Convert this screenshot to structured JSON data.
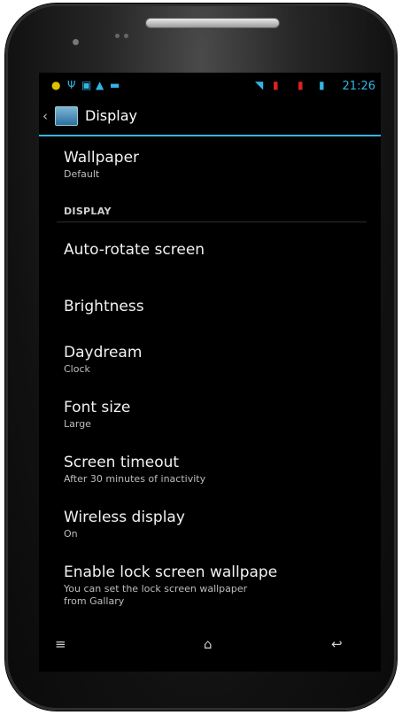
{
  "status_bar": {
    "time": "21:26",
    "icons": [
      "notification-icon",
      "usb-icon",
      "image-icon",
      "warning-icon",
      "game-icon",
      "wifi-icon",
      "signal-icon",
      "signal-icon",
      "battery-icon"
    ]
  },
  "action_bar": {
    "title": "Display"
  },
  "settings": {
    "wallpaper": {
      "title": "Wallpaper",
      "summary": "Default"
    },
    "category": "DISPLAY",
    "auto_rotate": {
      "title": "Auto-rotate screen"
    },
    "brightness": {
      "title": "Brightness"
    },
    "daydream": {
      "title": "Daydream",
      "summary": "Clock"
    },
    "font_size": {
      "title": "Font size",
      "summary": "Large"
    },
    "screen_timeout": {
      "title": "Screen timeout",
      "summary": "After 30 minutes of inactivity"
    },
    "wireless_display": {
      "title": "Wireless display",
      "summary": "On"
    },
    "lock_wallpaper": {
      "title": "Enable lock screen wallpape",
      "summary": "You can set the lock screen wallpaper from Gallary"
    }
  },
  "nav": {
    "menu_glyph": "≡",
    "home_glyph": "⌂",
    "back_glyph": "↩"
  },
  "colors": {
    "accent": "#33b5e5",
    "background": "#000000"
  }
}
